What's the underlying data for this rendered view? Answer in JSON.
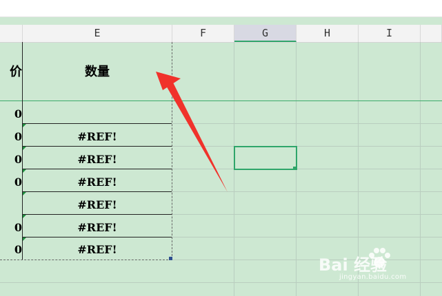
{
  "column_headers": [
    {
      "label": "E",
      "selected": false
    },
    {
      "label": "F",
      "selected": false
    },
    {
      "label": "G",
      "selected": true
    },
    {
      "label": "H",
      "selected": false
    },
    {
      "label": "I",
      "selected": false
    }
  ],
  "header_row": {
    "d_partial": "价",
    "e_title": "数量"
  },
  "rows": [
    {
      "d": "0",
      "e": ""
    },
    {
      "d": "0",
      "e": "#REF!"
    },
    {
      "d": "0",
      "e": "#REF!"
    },
    {
      "d": "0",
      "e": "#REF!"
    },
    {
      "d": "",
      "e": "#REF!"
    },
    {
      "d": "0",
      "e": "#REF!"
    },
    {
      "d": "0",
      "e": "#REF!"
    }
  ],
  "watermark": {
    "brand": "Bai 经验",
    "url": "jingyan.baidu.com"
  },
  "colors": {
    "sheet_background": "#cde8d2",
    "selection_green": "#2fa56a",
    "arrow_red": "#f0322b"
  }
}
